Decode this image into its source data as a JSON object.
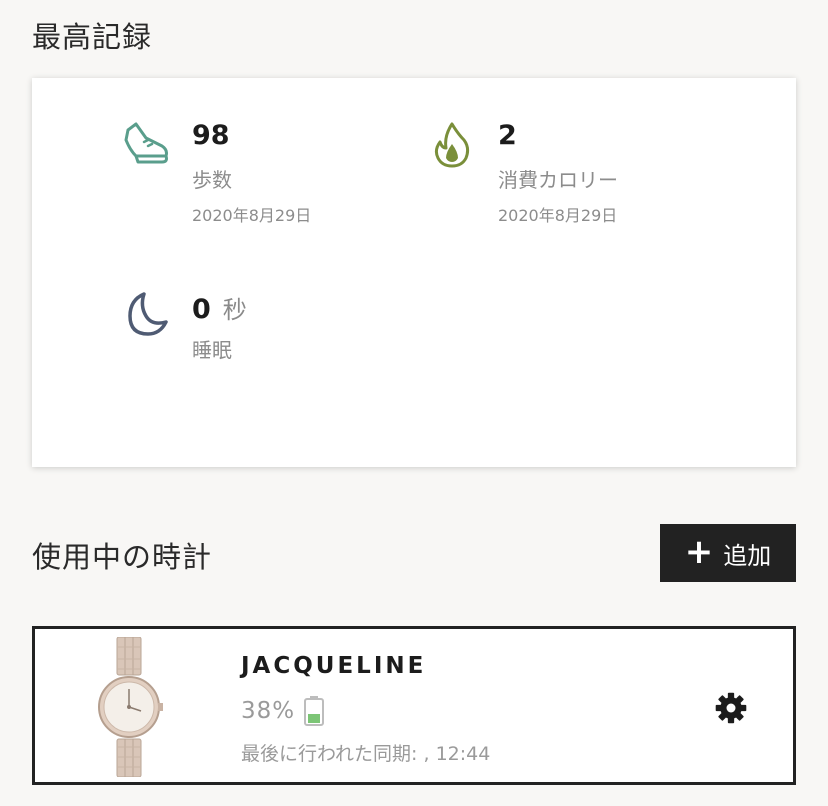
{
  "records": {
    "title": "最高記録",
    "steps": {
      "value": "98",
      "label": "歩数",
      "date": "2020年8月29日",
      "icon": "shoe-icon",
      "color": "#5a9e8c"
    },
    "calories": {
      "value": "2",
      "label": "消費カロリー",
      "date": "2020年8月29日",
      "icon": "flame-icon",
      "color": "#7a8f3a"
    },
    "sleep": {
      "value": "0",
      "unit": "秒",
      "label": "睡眠",
      "icon": "moon-icon",
      "color": "#4f5b73"
    }
  },
  "watches": {
    "title": "使用中の時計",
    "add_label": "追加",
    "items": [
      {
        "name": "JACQUELINE",
        "battery_percent": "38%",
        "battery_level": 0.38,
        "battery_color": "#7cc576",
        "last_sync": "最後に行われた同期: , 12:44",
        "settings_icon": "gear-icon"
      }
    ]
  }
}
